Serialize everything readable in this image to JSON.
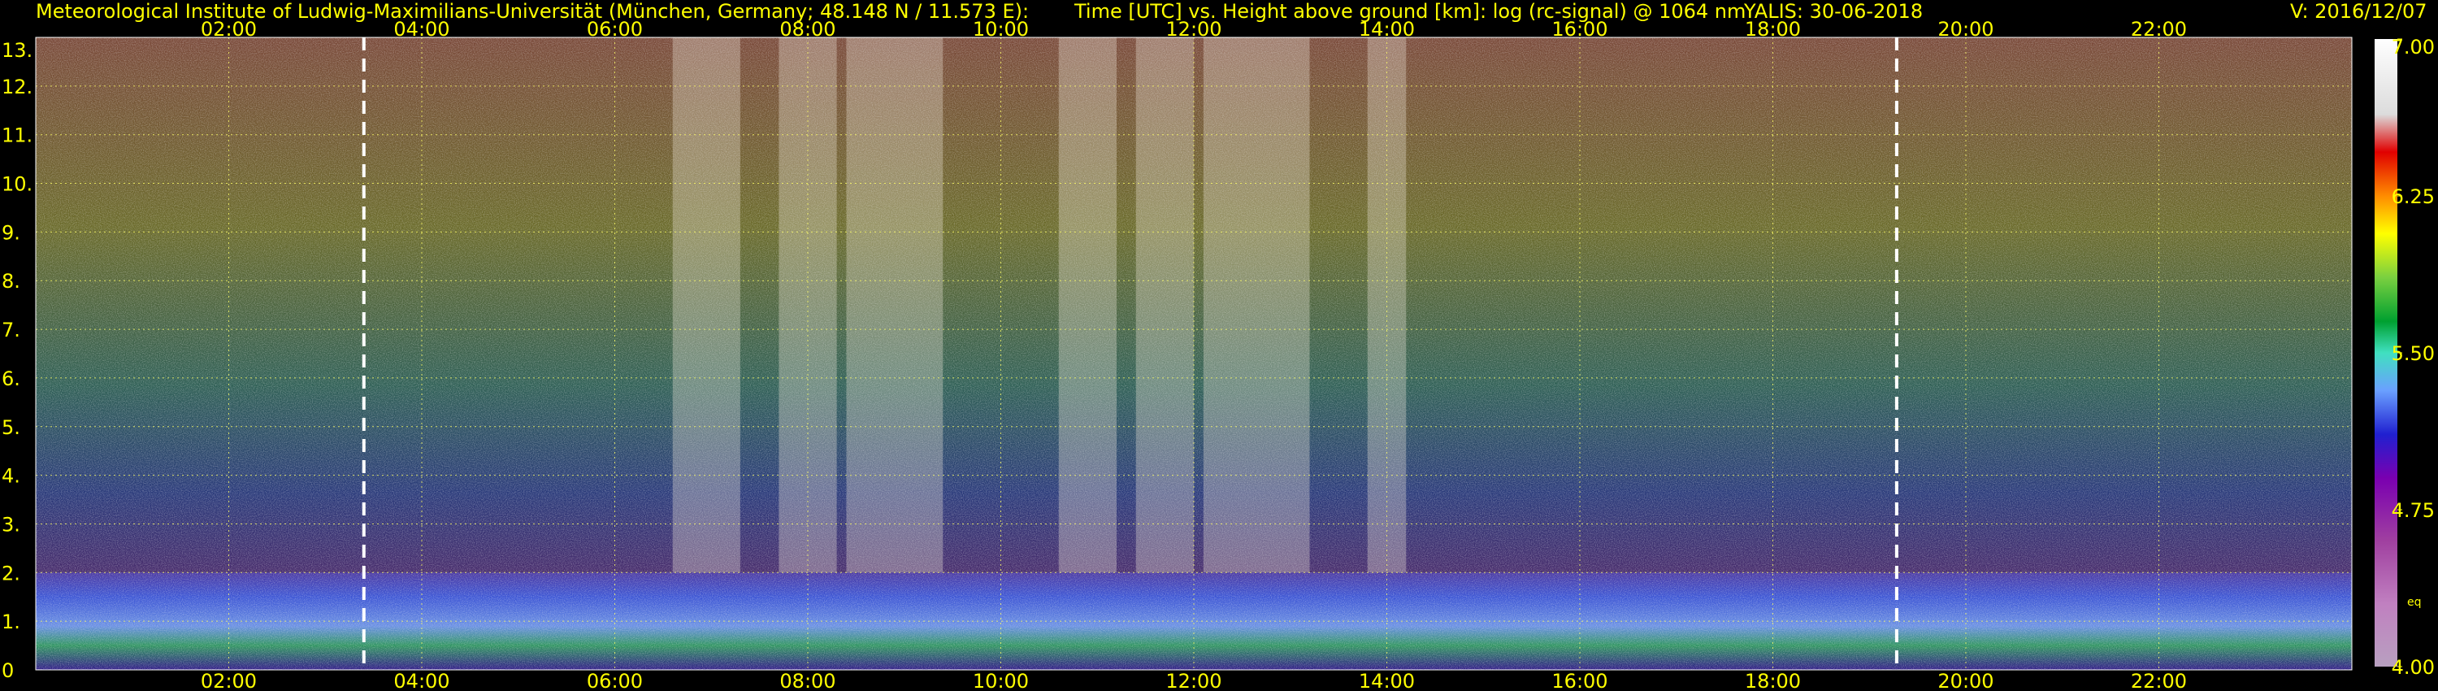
{
  "header": {
    "institute": "Meteorological Institute of Ludwig-Maximilians-Universität (München, Germany; 48.148 N / 11.573 E):",
    "title": "Time [UTC] vs. Height above ground [km]: log (rc-signal) @ 1064 nm",
    "instrument_date": "YALIS: 30-06-2018",
    "version": "V: 2016/12/07"
  },
  "colors": {
    "text": "#ffff00",
    "grid": "#ffff66",
    "background": "#000000",
    "marker": "#ffffff"
  },
  "colorbar": {
    "ticks": [
      "7.00",
      "6.25",
      "5.50",
      "4.75",
      "4.00"
    ],
    "unit_label": "eq"
  },
  "chart_data": {
    "type": "heatmap",
    "title": "Time [UTC] vs. Height above ground [km]: log (rc-signal) @ 1064 nm",
    "xlabel": "Time [UTC]",
    "ylabel": "Height above ground [km]",
    "x_range": [
      "00:00",
      "24:00"
    ],
    "x_ticks": [
      "02:00",
      "04:00",
      "06:00",
      "08:00",
      "10:00",
      "12:00",
      "14:00",
      "16:00",
      "18:00",
      "20:00",
      "22:00"
    ],
    "y_range": [
      0,
      13
    ],
    "y_ticks": [
      "0",
      "1.",
      "2.",
      "3.",
      "4.",
      "5.",
      "6.",
      "7.",
      "8.",
      "9.",
      "10.",
      "11.",
      "12.",
      "13."
    ],
    "color_range": [
      4.0,
      7.0
    ],
    "grid": true,
    "marker_times_utc": [
      "03:24",
      "19:17"
    ]
  }
}
